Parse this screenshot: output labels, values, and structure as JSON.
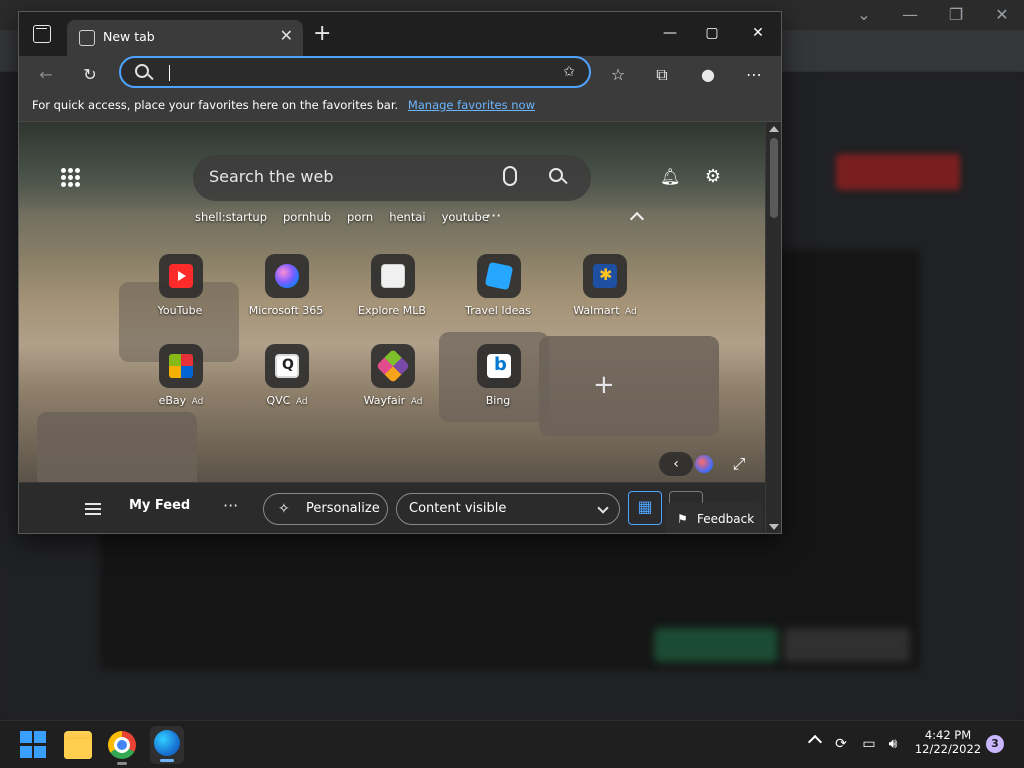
{
  "browser": {
    "tab": {
      "title": "New tab"
    },
    "address_bar": {
      "value": "",
      "placeholder": ""
    },
    "favorites_bar": {
      "message": "For quick access, place your favorites here on the favorites bar.",
      "link": "Manage favorites now"
    }
  },
  "newtab": {
    "search": {
      "placeholder": "Search the web"
    },
    "suggestions": [
      "shell:startup",
      "pornhub",
      "porn",
      "hentai",
      "youtube"
    ],
    "more_suggestions": "···",
    "tiles_row1": [
      {
        "label": "YouTube",
        "ad": ""
      },
      {
        "label": "Microsoft 365",
        "ad": ""
      },
      {
        "label": "Explore MLB",
        "ad": ""
      },
      {
        "label": "Travel Ideas",
        "ad": ""
      },
      {
        "label": "Walmart",
        "ad": "Ad"
      }
    ],
    "tiles_row2": [
      {
        "label": "eBay",
        "ad": "Ad"
      },
      {
        "label": "QVC",
        "ad": "Ad"
      },
      {
        "label": "Wayfair",
        "ad": "Ad"
      },
      {
        "label": "Bing",
        "ad": ""
      }
    ],
    "feed": {
      "title": "My Feed",
      "more": "···",
      "personalize_label": "Personalize",
      "content_visibility": "Content visible",
      "feedback_label": "Feedback"
    }
  },
  "taskbar": {
    "time": "4:42 PM",
    "date": "12/22/2022",
    "notifications": "3"
  },
  "colors": {
    "accent": "#4ea3ff",
    "window_bg": "#2b2b2b",
    "taskbar_bg": "#1f1f1f"
  }
}
